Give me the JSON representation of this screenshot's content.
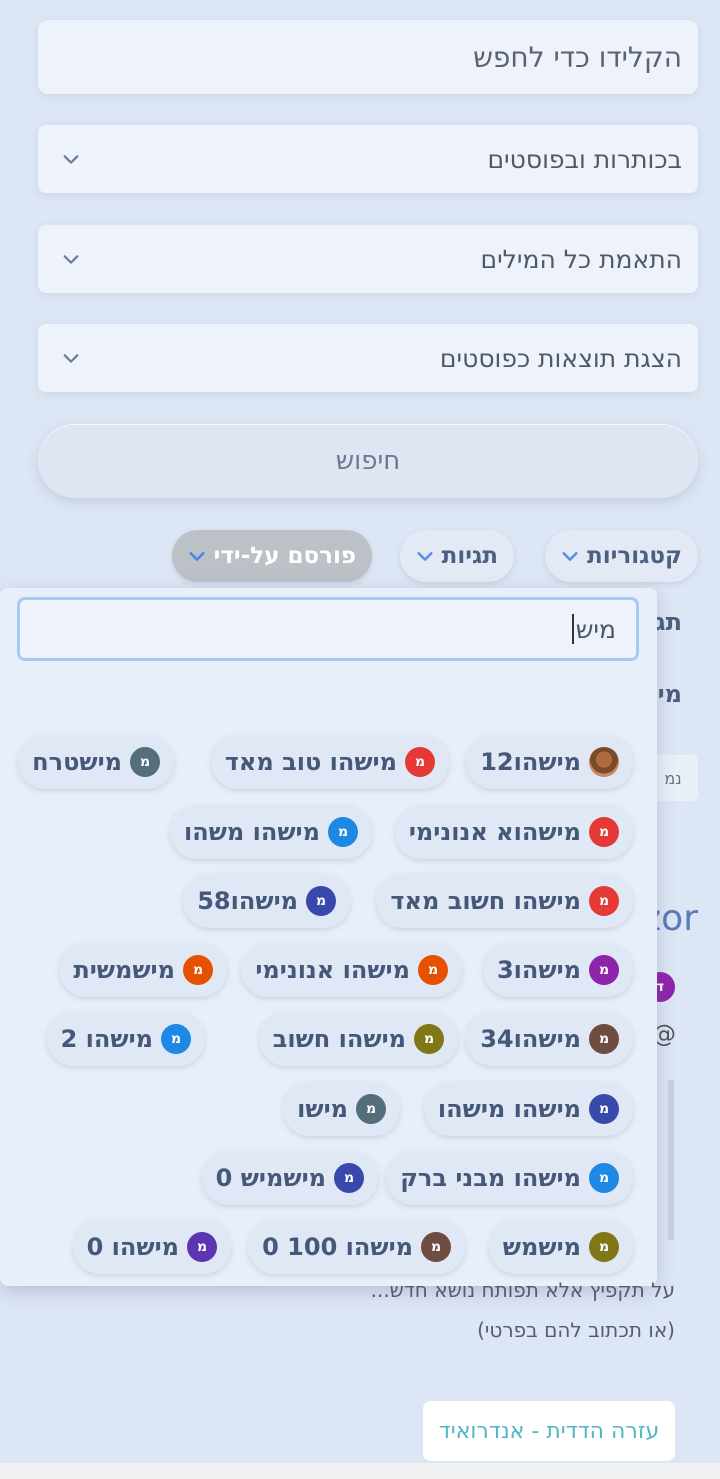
{
  "search": {
    "placeholder": "הקלידו כדי לחפש"
  },
  "selects": {
    "search_in": "בכותרות ובפוסטים",
    "match": "התאמת כל המילים",
    "show_results": "הצגת תוצאות כפוסטים"
  },
  "search_button": "חיפוש",
  "filters": {
    "categories": "קטגוריות",
    "tags": "תגיות",
    "posted_by": "פורסם על-ידי"
  },
  "background_fragments": {
    "frag1": "תג",
    "frag2": "מי",
    "frag3": "נמ",
    "frag4": "zor",
    "frag5": "@"
  },
  "user_dropdown": {
    "query": "מיש",
    "users": [
      {
        "name": "מישהו12",
        "avatar": "photo",
        "color": "#c0704a"
      },
      {
        "name": "מישהו טוב מאד",
        "avatar": "מ",
        "color": "#e53935"
      },
      {
        "name": "מישטרח",
        "avatar": "מ",
        "color": "#546e7a"
      },
      {
        "name": "מישהוא אנונימי",
        "avatar": "מ",
        "color": "#e53935"
      },
      {
        "name": "מישהו משהו",
        "avatar": "מ",
        "color": "#1e88e5"
      },
      {
        "name": "מישהו חשוב מאד",
        "avatar": "מ",
        "color": "#e53935"
      },
      {
        "name": "מישהו58",
        "avatar": "מ",
        "color": "#3949ab"
      },
      {
        "name": "מישהו3",
        "avatar": "מ",
        "color": "#8e24aa"
      },
      {
        "name": "מישהו אנונימי",
        "avatar": "מ",
        "color": "#e65100"
      },
      {
        "name": "מישמשית",
        "avatar": "מ",
        "color": "#e65100"
      },
      {
        "name": "מישהו34",
        "avatar": "מ",
        "color": "#6d4c41"
      },
      {
        "name": "מישהו חשוב",
        "avatar": "מ",
        "color": "#827717"
      },
      {
        "name": "מישהו 2",
        "avatar": "מ",
        "color": "#1e88e5"
      },
      {
        "name": "מישהו מישהו",
        "avatar": "מ",
        "color": "#3949ab"
      },
      {
        "name": "מישו",
        "avatar": "מ",
        "color": "#546e7a"
      },
      {
        "name": "מישהו מבני ברק",
        "avatar": "מ",
        "color": "#1e88e5"
      },
      {
        "name": "מישמיש 0",
        "avatar": "מ",
        "color": "#3949ab"
      },
      {
        "name": "מישמש",
        "avatar": "מ",
        "color": "#827717"
      },
      {
        "name": "מישהו 100 0",
        "avatar": "מ",
        "color": "#6d4c41"
      },
      {
        "name": "מישהו 0",
        "avatar": "מ",
        "color": "#5e35b1"
      }
    ]
  },
  "footer": {
    "line1": "על תקפיץ אלא תפותח נושא חדש...",
    "line2": "(או תכתוב להם בפרטי)",
    "help_link": "עזרה הדדית - אנדרואיד"
  }
}
